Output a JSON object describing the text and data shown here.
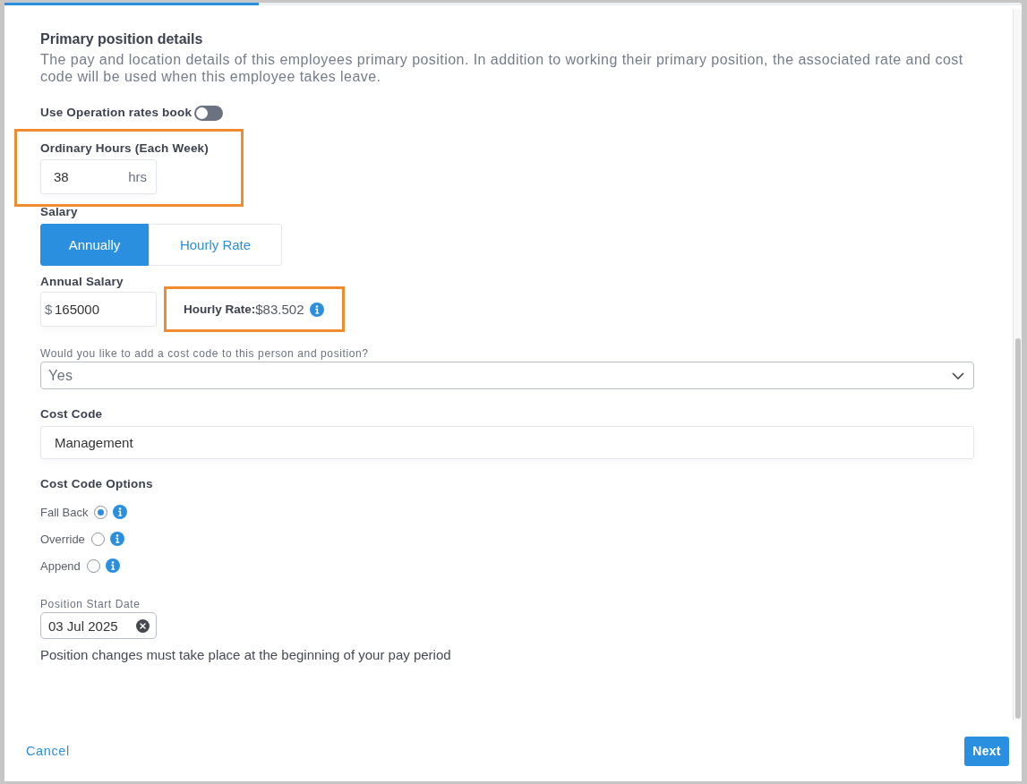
{
  "progress": {
    "level": 0.25
  },
  "section": {
    "title": "Primary position details",
    "description": "The pay and location details of this employees primary position. In addition to working their primary position, the associated rate and cost code will be used when this employee takes leave."
  },
  "rates_book_toggle": {
    "label": "Use Operation rates book",
    "on": false
  },
  "ordinary_hours": {
    "label": "Ordinary Hours (Each Week)",
    "value": "38",
    "suffix": "hrs",
    "highlighted": true
  },
  "salary": {
    "label": "Salary",
    "options": [
      {
        "label": "Annually",
        "selected": true
      },
      {
        "label": "Hourly Rate",
        "selected": false
      }
    ]
  },
  "annual_salary": {
    "label": "Annual Salary",
    "prefix": "$",
    "value": "165000"
  },
  "hourly_rate": {
    "label": "Hourly Rate:",
    "value": "$83.502",
    "highlighted": true
  },
  "cost_code_question": {
    "label": "Would you like to add a cost code to this person and position?",
    "value": "Yes"
  },
  "cost_code": {
    "label": "Cost Code",
    "value": "Management"
  },
  "cost_code_options": {
    "label": "Cost Code Options",
    "options": [
      {
        "label": "Fall Back",
        "selected": true
      },
      {
        "label": "Override",
        "selected": false
      },
      {
        "label": "Append",
        "selected": false
      }
    ]
  },
  "position_start_date": {
    "label": "Position Start Date",
    "value": "03 Jul 2025"
  },
  "note": "Position changes must take place at the beginning of your pay period",
  "footer": {
    "cancel": "Cancel",
    "next": "Next"
  }
}
